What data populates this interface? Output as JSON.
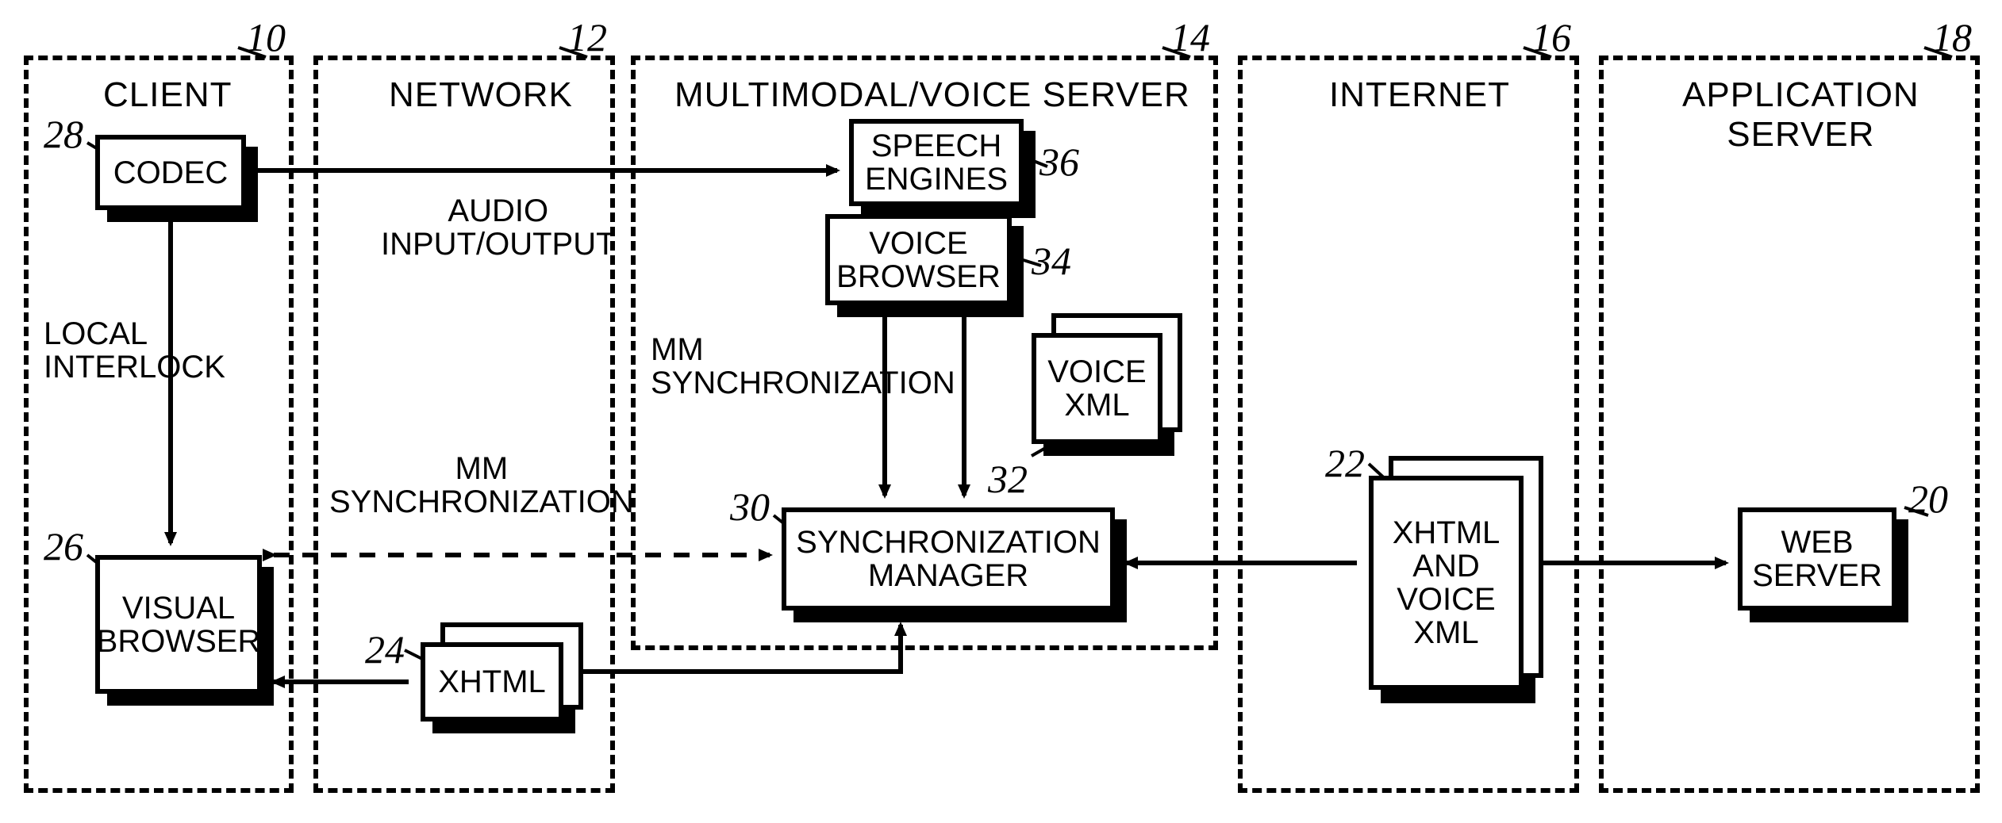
{
  "refs": {
    "client": "10",
    "network": "12",
    "mmserver": "14",
    "internet": "16",
    "appserver": "18",
    "webserver": "20",
    "xhtml_voice": "22",
    "xhtml": "24",
    "visual_browser": "26",
    "codec": "28",
    "sync_mgr": "30",
    "voice_xml": "32",
    "voice_browser": "34",
    "speech_engines": "36"
  },
  "regions": {
    "client": "CLIENT",
    "network": "NETWORK",
    "mmserver": "MULTIMODAL/VOICE SERVER",
    "internet": "INTERNET",
    "appserver": "APPLICATION\nSERVER"
  },
  "boxes": {
    "codec": "CODEC",
    "visual_browser": "VISUAL\nBROWSER",
    "xhtml": "XHTML",
    "speech_engines": "SPEECH\nENGINES",
    "voice_browser": "VOICE\nBROWSER",
    "voice_xml": "VOICE\nXML",
    "sync_mgr": "SYNCHRONIZATION\nMANAGER",
    "xhtml_voice": "XHTML\nAND\nVOICE\nXML",
    "webserver": "WEB\nSERVER"
  },
  "labels": {
    "audio_io": "AUDIO\nINPUT/OUTPUT",
    "local_interlock": "LOCAL\nINTERLOCK",
    "mm_sync_net": "MM\nSYNCHRONIZATION",
    "mm_sync_srv": "MM\nSYNCHRONIZATION"
  }
}
